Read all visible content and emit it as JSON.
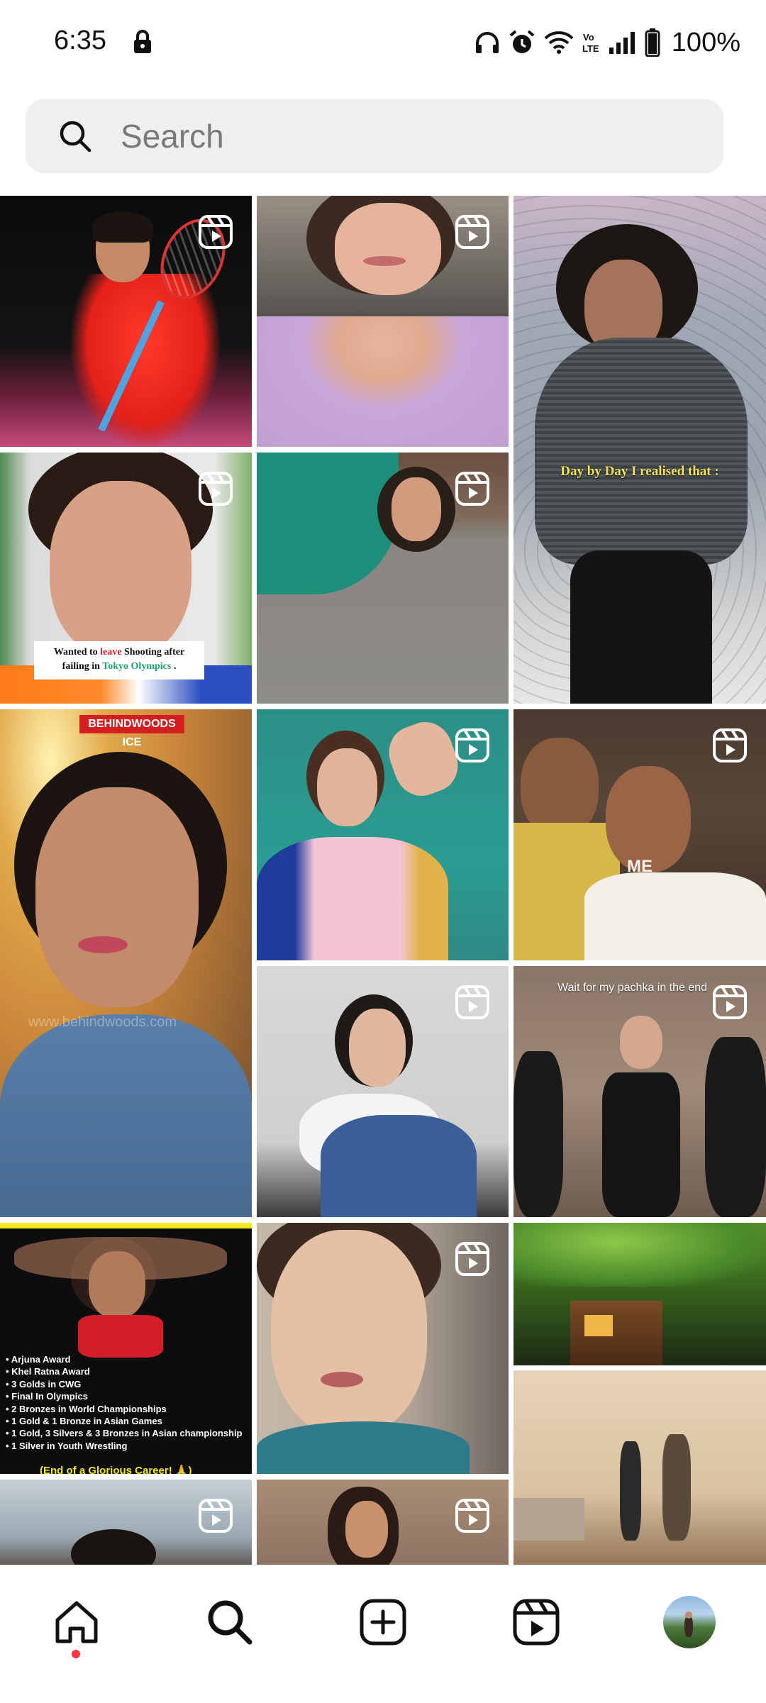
{
  "status_bar": {
    "time": "6:35",
    "battery": "100%",
    "icons": [
      "lock-icon",
      "headphones-icon",
      "alarm-icon",
      "wifi-icon",
      "volte-icon",
      "signal-icon",
      "battery-icon"
    ]
  },
  "search": {
    "placeholder": "Search"
  },
  "grid": {
    "tiles": [
      {
        "id": "badminton-player",
        "reel": true
      },
      {
        "id": "woman-lilac-kurta",
        "reel": true
      },
      {
        "id": "woman-lying-heart",
        "reel": false,
        "caption": "Day by Day I realised that :"
      },
      {
        "id": "shooter-closeup",
        "reel": true,
        "caption_parts": [
          "Wanted to ",
          "leave",
          " Shooting after",
          "failing in ",
          "Tokyo Olympics",
          " ."
        ]
      },
      {
        "id": "woman-green-saree",
        "reel": true
      },
      {
        "id": "behindwoods-interview",
        "reel": false,
        "badge": "BEHINDWOODS ICE",
        "watermark": "www.behindwoods.com"
      },
      {
        "id": "woman-waving",
        "reel": true
      },
      {
        "id": "two-men-reaction",
        "reel": true,
        "caption": "ME"
      },
      {
        "id": "woman-ripped-jeans",
        "reel": true
      },
      {
        "id": "women-dancing",
        "reel": true,
        "caption": "Wait for my pachka in the end"
      },
      {
        "id": "wrestler-career",
        "reel": false,
        "achievements": [
          "Arjuna Award",
          "Khel Ratna Award",
          "3 Golds in CWG",
          "Final In Olympics",
          "2 Bronzes in World Championships",
          "1 Gold & 1 Bronze in Asian Games",
          "1 Gold, 3 Silvers & 3 Bronzes in Asian championship",
          "1 Silver in Youth Wrestling"
        ],
        "footer": "(End of a Glorious Career! 🙏)"
      },
      {
        "id": "woman-closeup",
        "reel": true
      },
      {
        "id": "forest-treehouse",
        "reel": false
      },
      {
        "id": "room-two-men",
        "reel": false
      },
      {
        "id": "couple-partial",
        "reel": true
      },
      {
        "id": "woman-saree-partial",
        "reel": true
      }
    ]
  },
  "bottom_nav": {
    "items": [
      "home-icon",
      "search-icon",
      "create-icon",
      "reels-icon",
      "profile-avatar"
    ],
    "active": "home"
  },
  "colors": {
    "accent_red": "#ff3040",
    "search_bg": "#efefef"
  }
}
